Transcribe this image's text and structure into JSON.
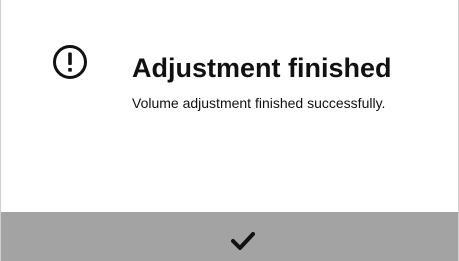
{
  "dialog": {
    "title": "Adjustment finished",
    "message": "Volume adjustment finished successfully.",
    "status_icon": "exclamation-circle-icon",
    "confirm_icon": "checkmark-icon"
  },
  "colors": {
    "background": "#ffffff",
    "text": "#111111",
    "confirm_bar": "#a3a3a3",
    "icon": "#111111"
  }
}
